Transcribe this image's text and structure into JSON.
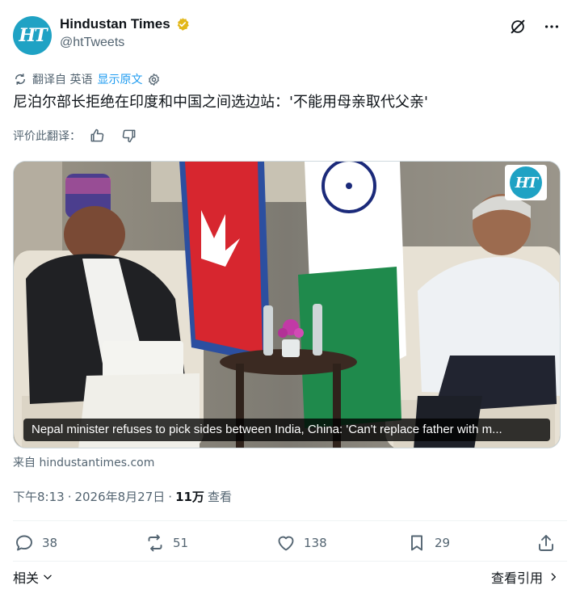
{
  "account": {
    "display_name": "Hindustan Times",
    "handle": "@htTweets",
    "avatar_text": "HT"
  },
  "translation": {
    "label": "翻译自 英语",
    "show_original": "显示原文",
    "rate_label": "评价此翻译："
  },
  "tweet": {
    "text": "尼泊尔部长拒绝在印度和中国之间选边站：'不能用母亲取代父亲'"
  },
  "media": {
    "caption": "Nepal minister refuses to pick sides between India, China: 'Can't replace father with m...",
    "watermark_text": "HT"
  },
  "source": "来自 hindustantimes.com",
  "meta": {
    "time": "下午8:13",
    "date": "2026年8月27日",
    "separator": "·",
    "views": "11万",
    "views_label": "查看"
  },
  "actions": {
    "replies": "38",
    "retweets": "51",
    "likes": "138",
    "bookmarks": "29"
  },
  "footer": {
    "related": "相关",
    "view_quotes": "查看引用"
  },
  "colors": {
    "brand_blue": "#1fa2c4",
    "link_blue": "#1d9bf0",
    "verified_gold": "#e2b719",
    "muted_text": "#536471"
  }
}
